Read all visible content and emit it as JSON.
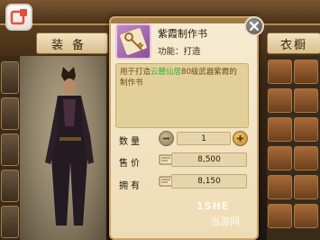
{
  "tabs": {
    "equip": "装备",
    "wardrobe": "衣橱"
  },
  "item": {
    "name": "紫霞制作书",
    "function": "功能：打造",
    "description_prefix": "用于打造",
    "description_highlight": "云麓仙居",
    "description_suffix": "80级武器紫霞的制作书",
    "icon": "scroll-key-icon"
  },
  "quantity": {
    "label": "数量",
    "value": "1"
  },
  "price": {
    "label": "售价",
    "value": "8,500"
  },
  "owned": {
    "label": "拥有",
    "value": "8,150"
  },
  "watermark": {
    "logo": "1SHE",
    "text": "当游网"
  },
  "colors": {
    "popup_bg": "#f7ecd2",
    "desc_bg": "#e3cf9a",
    "highlight": "#3fb43a",
    "plus": "#f3c866"
  }
}
